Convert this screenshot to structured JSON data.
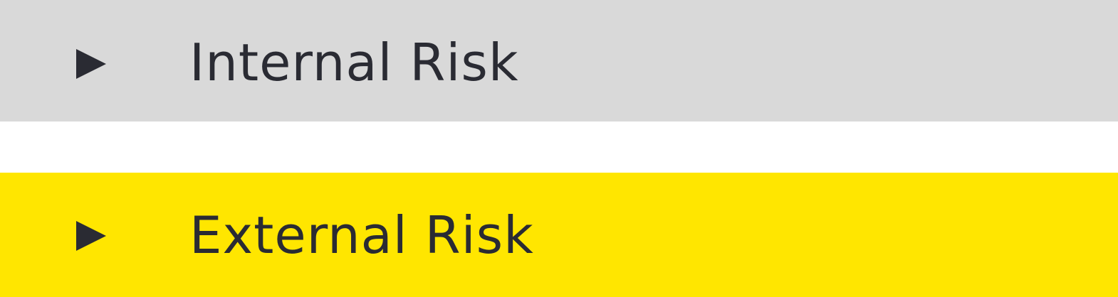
{
  "accordion": {
    "items": [
      {
        "label": "Internal Risk",
        "icon": "triangle-right-icon",
        "background": "#d9d9d9",
        "text_color": "#2a2b33"
      },
      {
        "label": "External Risk",
        "icon": "triangle-right-icon",
        "background": "#ffe600",
        "text_color": "#2a2b33"
      }
    ]
  }
}
